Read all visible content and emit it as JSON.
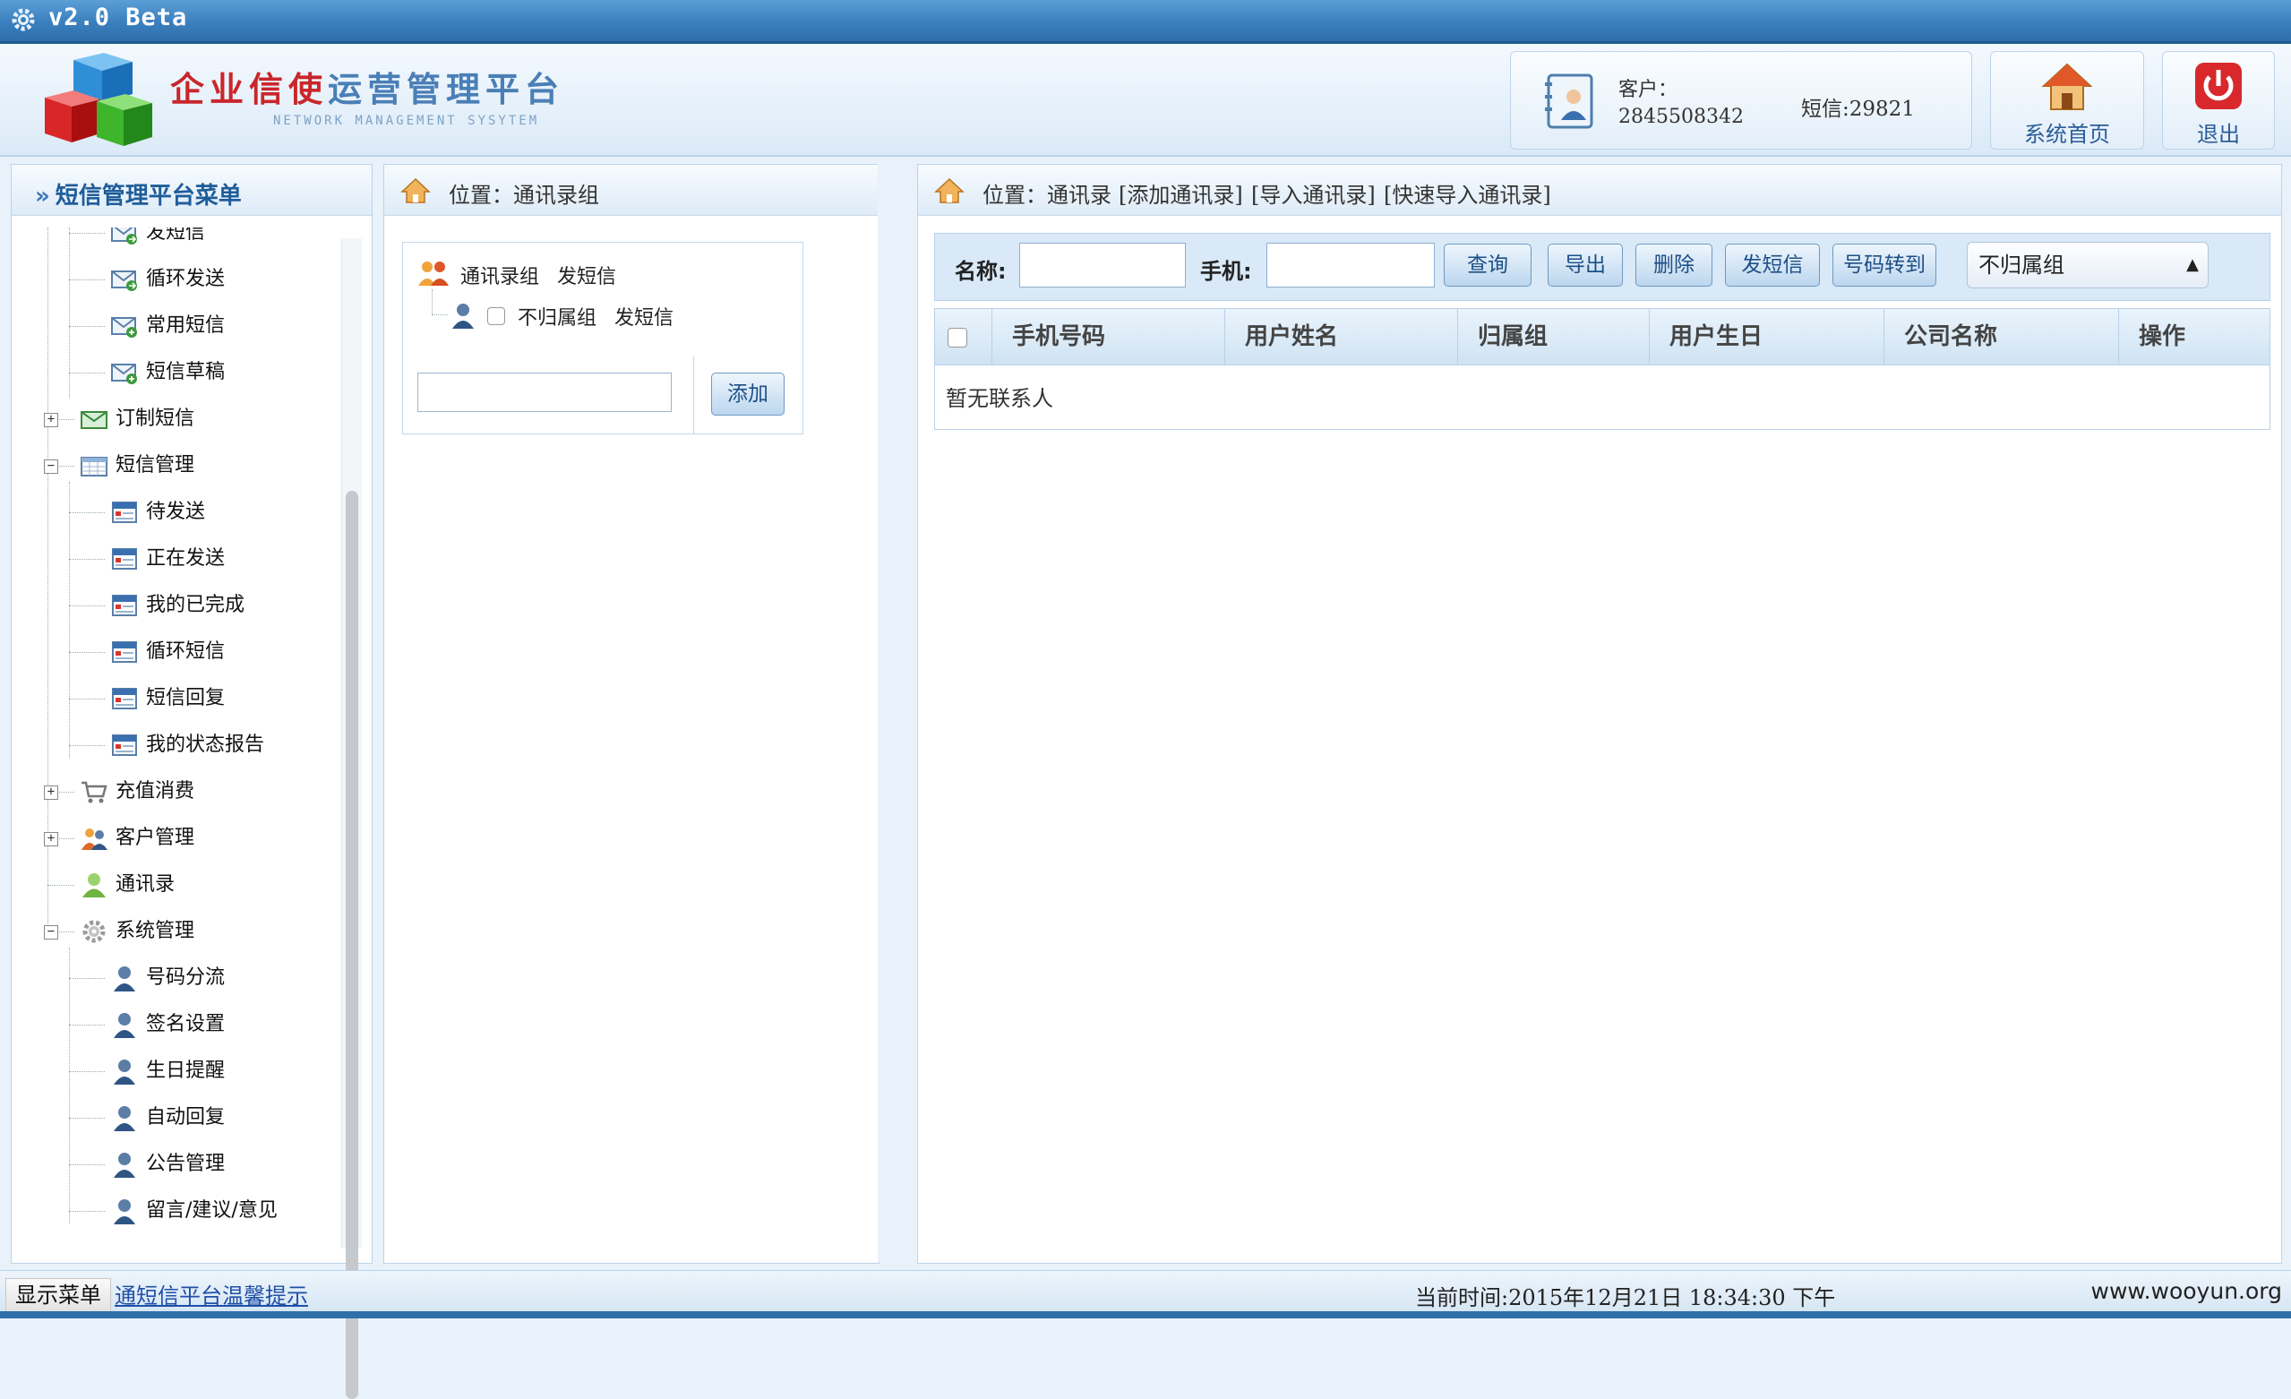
{
  "titlebar": {
    "version": "v2.0 Beta"
  },
  "header": {
    "brand_red": "企业信使",
    "brand_blue": "运营管理平台",
    "brand_sub": "NETWORK MANAGEMENT SYSYTEM",
    "customer_label": "客户：",
    "customer_account": "2845508342",
    "sms_balance": "短信:29821",
    "home_label": "系统首页",
    "exit_label": "退出"
  },
  "sidebar": {
    "title": "短信管理平台菜单",
    "items": [
      {
        "label": "发短信",
        "icon": "envelope-arrow-icon",
        "level": 2
      },
      {
        "label": "循环发送",
        "icon": "envelope-arrow-icon",
        "level": 2
      },
      {
        "label": "常用短信",
        "icon": "envelope-plus-icon",
        "level": 2
      },
      {
        "label": "短信草稿",
        "icon": "envelope-plus-icon",
        "level": 2
      },
      {
        "label": "订制短信",
        "icon": "mail-icon",
        "level": 1,
        "toggle": "+"
      },
      {
        "label": "短信管理",
        "icon": "table-icon",
        "level": 1,
        "toggle": "−"
      },
      {
        "label": "待发送",
        "icon": "calendar-icon",
        "level": 2
      },
      {
        "label": "正在发送",
        "icon": "calendar-icon",
        "level": 2
      },
      {
        "label": "我的已完成",
        "icon": "calendar-icon",
        "level": 2
      },
      {
        "label": "循环短信",
        "icon": "calendar-icon",
        "level": 2
      },
      {
        "label": "短信回复",
        "icon": "calendar-icon",
        "level": 2
      },
      {
        "label": "我的状态报告",
        "icon": "calendar-icon",
        "level": 2
      },
      {
        "label": "充值消费",
        "icon": "cart-icon",
        "level": 1,
        "toggle": "+"
      },
      {
        "label": "客户管理",
        "icon": "users-icon",
        "level": 1,
        "toggle": "+"
      },
      {
        "label": "通讯录",
        "icon": "contact-icon",
        "level": 1
      },
      {
        "label": "系统管理",
        "icon": "gear-icon",
        "level": 1,
        "toggle": "−"
      },
      {
        "label": "号码分流",
        "icon": "user-icon",
        "level": 2
      },
      {
        "label": "签名设置",
        "icon": "user-icon",
        "level": 2
      },
      {
        "label": "生日提醒",
        "icon": "user-icon",
        "level": 2
      },
      {
        "label": "自动回复",
        "icon": "user-icon",
        "level": 2
      },
      {
        "label": "公告管理",
        "icon": "user-icon",
        "level": 2
      },
      {
        "label": "留言/建议/意见",
        "icon": "user-icon",
        "level": 2
      }
    ]
  },
  "middle": {
    "position": "位置：通讯录组",
    "root_label": "通讯录组",
    "root_send": "发短信",
    "child_label": "不归属组",
    "child_send": "发短信",
    "add_button": "添加",
    "add_input_value": ""
  },
  "right": {
    "position_prefix": "位置：通讯录",
    "link_add": "[添加通讯录]",
    "link_import": "[导入通讯录]",
    "link_quick_import": "[快速导入通讯录]",
    "name_label": "名称:",
    "phone_label": "手机:",
    "name_value": "",
    "phone_value": "",
    "buttons": {
      "query": "查询",
      "export": "导出",
      "delete": "删除",
      "send_sms": "发短信",
      "move_to": "号码转到"
    },
    "group_select": "不归属组",
    "table": {
      "columns": [
        "手机号码",
        "用户姓名",
        "归属组",
        "用户生日",
        "公司名称",
        "操作"
      ],
      "empty_text": "暂无联系人"
    }
  },
  "statusbar": {
    "show_menu": "显示菜单",
    "tip": "通短信平台温馨提示",
    "current_time": "当前时间:2015年12月21日 18:34:30 下午",
    "site": "www.wooyun.org"
  },
  "colors": {
    "brand_red": "#c9262b",
    "brand_blue": "#4a7fb6",
    "title_bar": "#3a7fbe",
    "link": "#1f4fa8"
  }
}
